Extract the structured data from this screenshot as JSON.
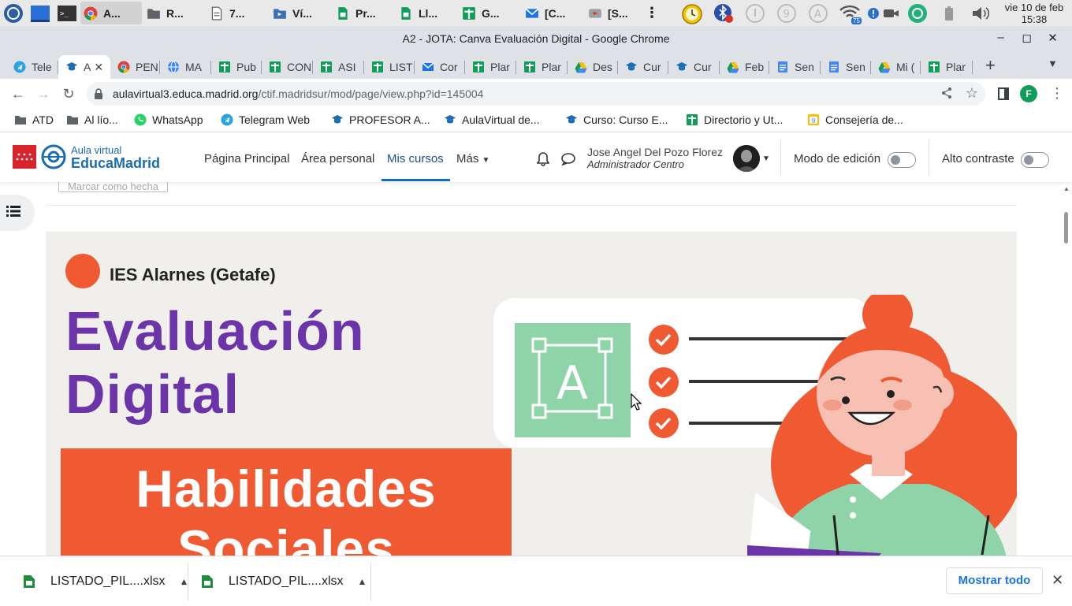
{
  "os": {
    "tasks": [
      {
        "label": "A...",
        "icon": "chrome-icon",
        "active": true
      },
      {
        "label": "R...",
        "icon": "folder-icon"
      },
      {
        "label": "7...",
        "icon": "document-icon"
      },
      {
        "label": "Ví...",
        "icon": "video-folder-icon"
      },
      {
        "label": "Pr...",
        "icon": "sheet-icon"
      },
      {
        "label": "Ll...",
        "icon": "sheet-icon"
      },
      {
        "label": "G...",
        "icon": "plus-sheet-icon"
      },
      {
        "label": "[C...",
        "icon": "mail-icon"
      },
      {
        "label": "[S...",
        "icon": "video-icon"
      }
    ],
    "wifi_badge": "75",
    "clock_day": "vie 10 de feb",
    "clock_time": "15:38"
  },
  "window": {
    "title": "A2 - JOTA: Canva Evaluación Digital - Google Chrome"
  },
  "tabs": [
    {
      "label": "Tele",
      "icon": "telegram-icon"
    },
    {
      "label": "A",
      "icon": "moodle-icon",
      "active": true
    },
    {
      "label": "PEN",
      "icon": "chrome-icon"
    },
    {
      "label": "MA",
      "icon": "globe-icon"
    },
    {
      "label": "Pub",
      "icon": "plus-sheet-icon"
    },
    {
      "label": "CON",
      "icon": "plus-sheet-icon"
    },
    {
      "label": "ASI",
      "icon": "plus-sheet-icon"
    },
    {
      "label": "LIST",
      "icon": "plus-sheet-icon"
    },
    {
      "label": "Cor",
      "icon": "mail-icon"
    },
    {
      "label": "Plar",
      "icon": "plus-sheet-icon"
    },
    {
      "label": "Plar",
      "icon": "plus-sheet-icon"
    },
    {
      "label": "Des",
      "icon": "drive-icon"
    },
    {
      "label": "Cur",
      "icon": "moodle-icon"
    },
    {
      "label": "Cur",
      "icon": "moodle-icon"
    },
    {
      "label": "Feb",
      "icon": "drive-icon"
    },
    {
      "label": "Sen",
      "icon": "docs-icon"
    },
    {
      "label": "Sen",
      "icon": "docs-icon"
    },
    {
      "label": "Mi (",
      "icon": "drive-icon"
    },
    {
      "label": "Plar",
      "icon": "plus-sheet-icon"
    }
  ],
  "omnibox": {
    "host": "aulavirtual3.educa.madrid.org",
    "path": "/ctif.madridsur/mod/page/view.php?id=145004"
  },
  "profile_initial": "F",
  "bookmarks": [
    {
      "label": "ATD",
      "icon": "folder-icon"
    },
    {
      "label": "Al lío...",
      "icon": "folder-icon"
    },
    {
      "label": "WhatsApp",
      "icon": "whatsapp-icon"
    },
    {
      "label": "Telegram Web",
      "icon": "telegram-icon"
    },
    {
      "label": "PROFESOR A...",
      "icon": "moodle-icon"
    },
    {
      "label": "AulaVirtual de...",
      "icon": "moodle-icon"
    },
    {
      "label": "Curso: Curso E...",
      "icon": "moodle-icon"
    },
    {
      "label": "Directorio y Ut...",
      "icon": "plus-sheet-icon"
    },
    {
      "label": "Consejería de...",
      "icon": "sites-icon"
    }
  ],
  "moodle": {
    "brand_small": "Aula virtual",
    "brand_big": "EducaMadrid",
    "nav": [
      "Página Principal",
      "Área personal",
      "Mis cursos",
      "Más"
    ],
    "user_name": "Jose Angel Del Pozo Florez",
    "user_role": "Administrador Centro",
    "edit_mode_label": "Modo de edición",
    "contrast_label": "Alto contraste",
    "mark_done": "Marcar como hecha"
  },
  "poster": {
    "school": "IES Alarnes (Getafe)",
    "line1": "Evaluación",
    "line2": "Digital",
    "line3": "Habilidades",
    "line4": "Sociales",
    "badge_letter": "A",
    "colors": {
      "purple": "#6b34a8",
      "orange": "#ef5a33",
      "green": "#8fd4a8",
      "bg": "#f0efeb"
    }
  },
  "downloads": {
    "items": [
      "LISTADO_PIL....xlsx",
      "LISTADO_PIL....xlsx"
    ],
    "show_all": "Mostrar todo"
  }
}
